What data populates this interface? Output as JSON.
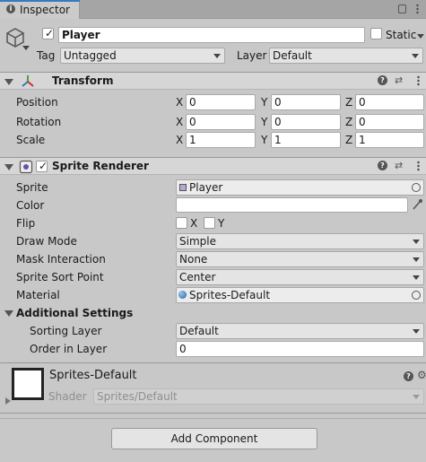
{
  "tab": {
    "title": "Inspector"
  },
  "gameobject": {
    "name": "Player",
    "static_label": "Static",
    "tag_label": "Tag",
    "tag_value": "Untagged",
    "layer_label": "Layer",
    "layer_value": "Default"
  },
  "transform": {
    "title": "Transform",
    "rows": [
      {
        "label": "Position",
        "x": "0",
        "y": "0",
        "z": "0"
      },
      {
        "label": "Rotation",
        "x": "0",
        "y": "0",
        "z": "0"
      },
      {
        "label": "Scale",
        "x": "1",
        "y": "1",
        "z": "1"
      }
    ],
    "axis_x": "X",
    "axis_y": "Y",
    "axis_z": "Z"
  },
  "sprite_renderer": {
    "title": "Sprite Renderer",
    "sprite_label": "Sprite",
    "sprite_value": "Player",
    "color_label": "Color",
    "flip_label": "Flip",
    "flip_x": "X",
    "flip_y": "Y",
    "draw_mode_label": "Draw Mode",
    "draw_mode_value": "Simple",
    "mask_label": "Mask Interaction",
    "mask_value": "None",
    "sort_point_label": "Sprite Sort Point",
    "sort_point_value": "Center",
    "material_label": "Material",
    "material_value": "Sprites-Default",
    "additional_label": "Additional Settings",
    "sorting_layer_label": "Sorting Layer",
    "sorting_layer_value": "Default",
    "order_label": "Order in Layer",
    "order_value": "0"
  },
  "material": {
    "name": "Sprites-Default",
    "shader_label": "Shader",
    "shader_value": "Sprites/Default"
  },
  "add_component_label": "Add Component",
  "colors": {
    "accent": "#3a79bb",
    "panel": "#c8c8c8",
    "header": "#d6d6d6"
  }
}
